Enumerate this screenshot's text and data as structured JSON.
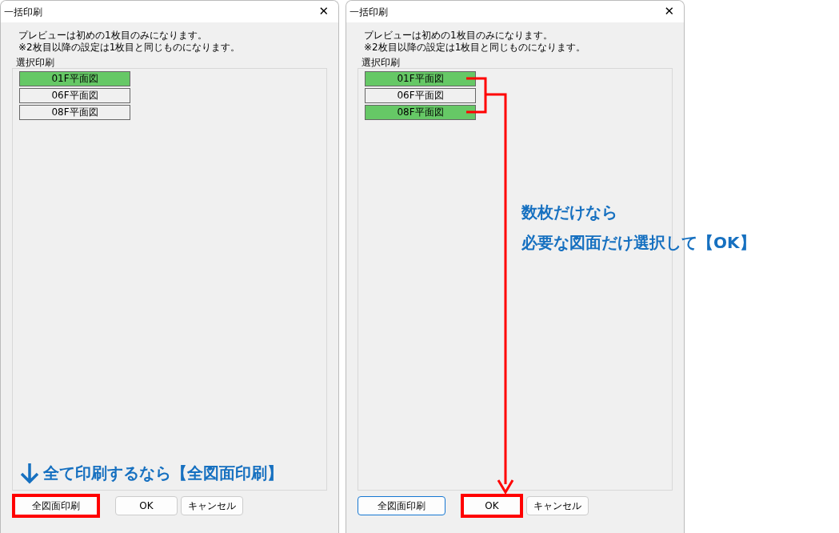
{
  "dialogs": [
    {
      "title": "一括印刷",
      "close": "✕",
      "notes": [
        "プレビューは初めの1枚目のみになります。",
        "※2枚目以降の設定は1枚目と同じものになります。"
      ],
      "group_label": "選択印刷",
      "items": [
        {
          "label": "01F平面図",
          "selected": true
        },
        {
          "label": "06F平面図",
          "selected": false
        },
        {
          "label": "08F平面図",
          "selected": false
        }
      ],
      "callout": "全て印刷するなら【全図面印刷】",
      "buttons": [
        {
          "label": "全図面印刷",
          "highlighted": true,
          "focused": false
        },
        {
          "label": "OK",
          "highlighted": false,
          "focused": false
        },
        {
          "label": "キャンセル",
          "highlighted": false,
          "focused": false
        }
      ]
    },
    {
      "title": "一括印刷",
      "close": "✕",
      "notes": [
        "プレビューは初めの1枚目のみになります。",
        "※2枚目以降の設定は1枚目と同じものになります。"
      ],
      "group_label": "選択印刷",
      "items": [
        {
          "label": "01F平面図",
          "selected": true
        },
        {
          "label": "06F平面図",
          "selected": false
        },
        {
          "label": "08F平面図",
          "selected": true
        }
      ],
      "buttons": [
        {
          "label": "全図面印刷",
          "highlighted": false,
          "focused": true
        },
        {
          "label": "OK",
          "highlighted": true,
          "focused": false
        },
        {
          "label": "キャンセル",
          "highlighted": false,
          "focused": false
        }
      ]
    }
  ],
  "annotation": {
    "lines": [
      "数枚だけなら",
      "必要な図面だけ選択して【OK】"
    ]
  }
}
